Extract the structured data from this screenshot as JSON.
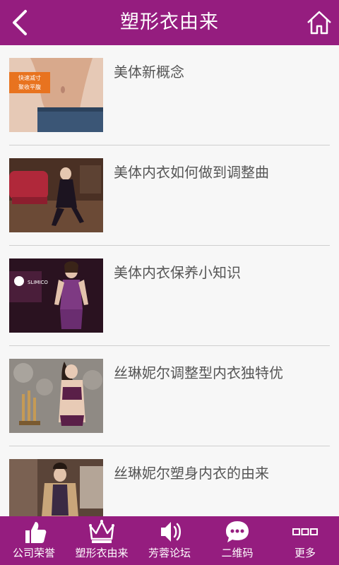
{
  "header": {
    "title": "塑形衣由来",
    "back_icon": "back-chevron-icon",
    "home_icon": "home-icon"
  },
  "articles": [
    {
      "title": "美体新概念",
      "thumb_caption_line1": "快速减寸",
      "thumb_caption_line2": "聚收平腹"
    },
    {
      "title": "美体内衣如何做到调整曲"
    },
    {
      "title": "美体内衣保养小知识",
      "thumb_brand": "SLIMICO"
    },
    {
      "title": "丝琳妮尔调整型内衣独特优"
    },
    {
      "title": "丝琳妮尔塑身内衣的由来"
    }
  ],
  "tabs": [
    {
      "label": "公司荣誉",
      "icon": "thumbs-up-icon"
    },
    {
      "label": "塑形衣由来",
      "icon": "crown-icon"
    },
    {
      "label": "芳蓉论坛",
      "icon": "speaker-icon"
    },
    {
      "label": "二维码",
      "icon": "chat-bubble-icon"
    },
    {
      "label": "更多",
      "icon": "more-squares-icon"
    }
  ],
  "colors": {
    "brand": "#951d7f",
    "background": "#f7f7f7",
    "divider": "#cfcfcf",
    "text": "#555555"
  }
}
